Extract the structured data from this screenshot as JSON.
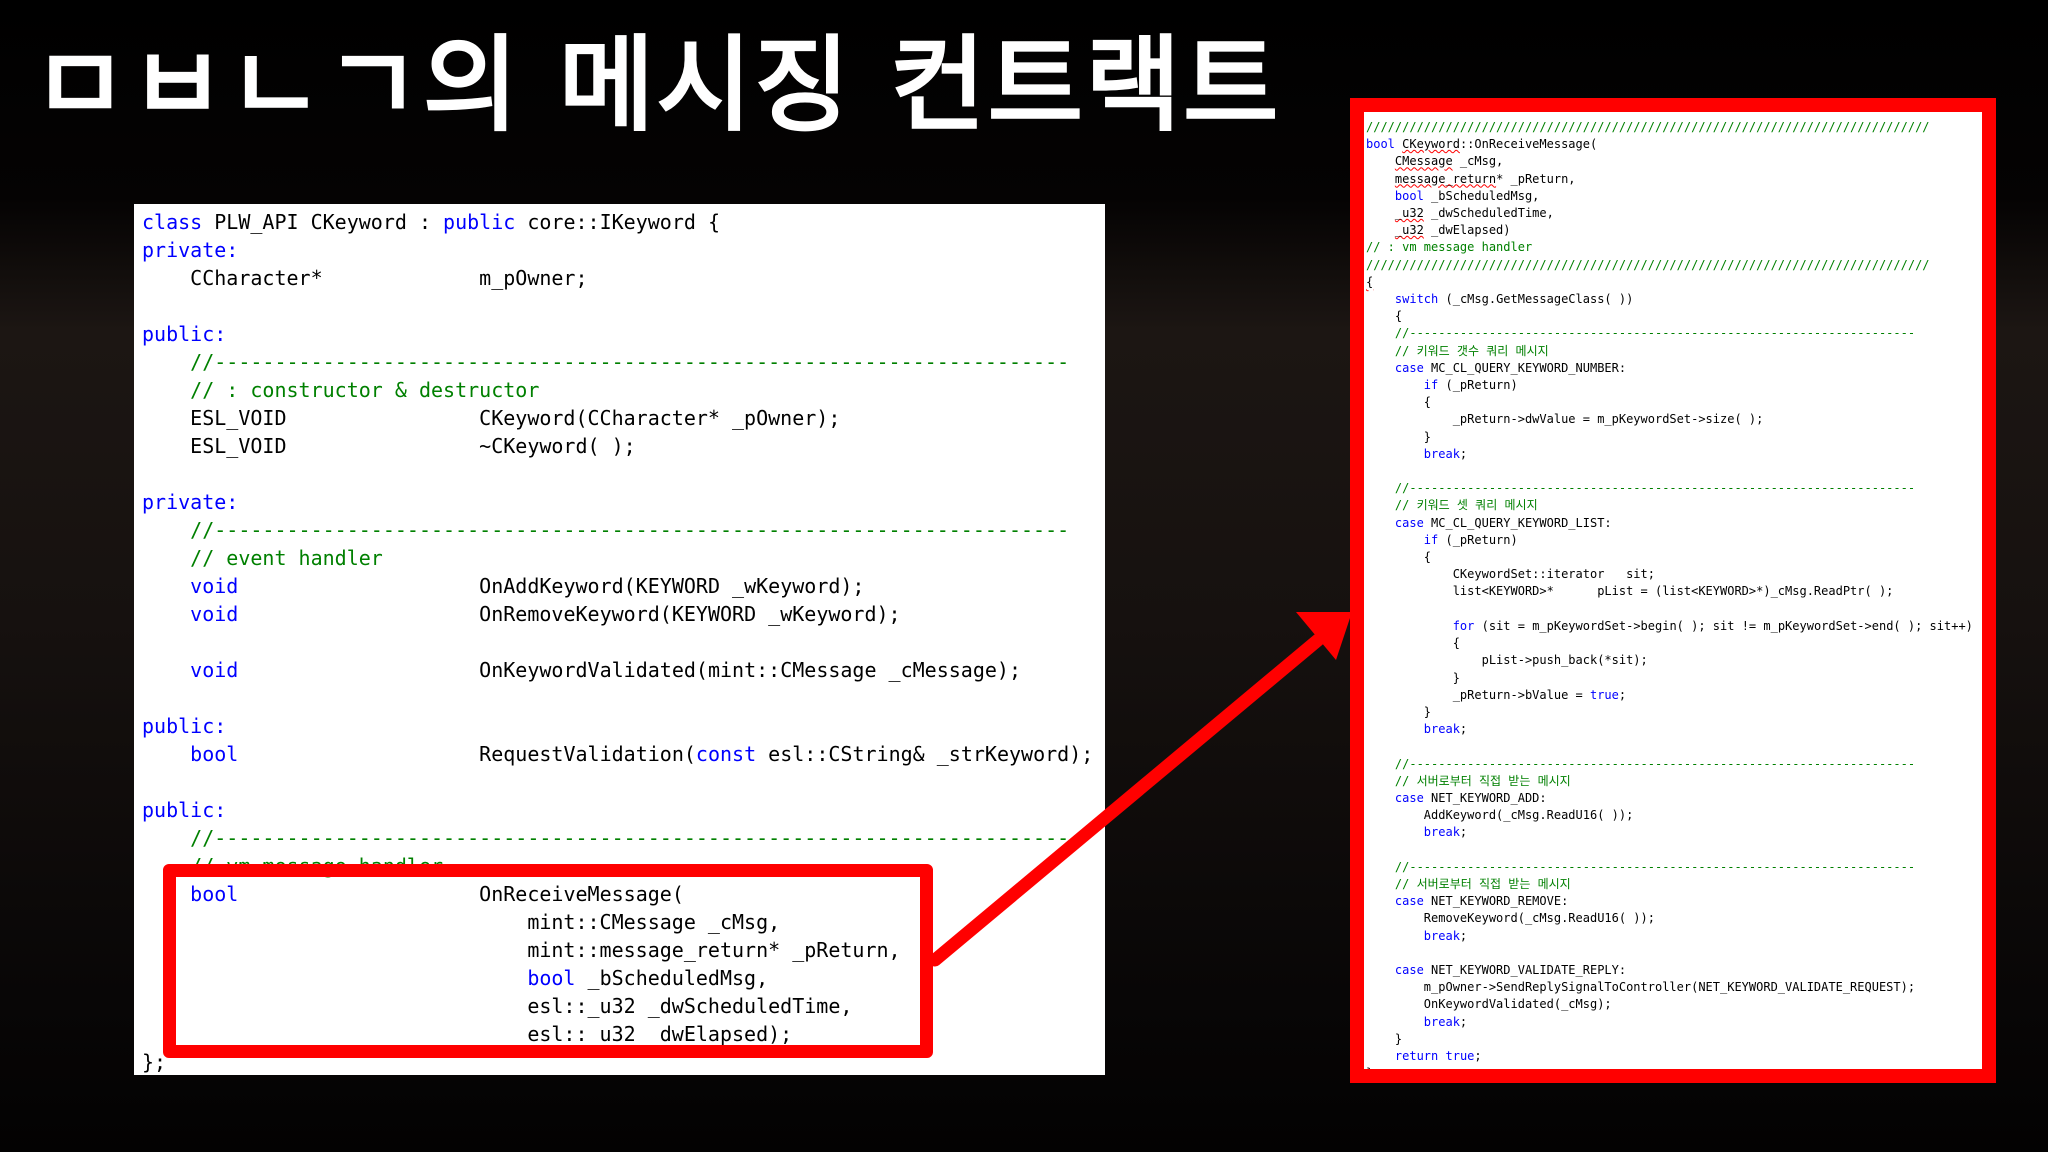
{
  "slide": {
    "title": "ㅁㅂㄴㄱ의 메시징 컨트랙트"
  },
  "colors": {
    "background": "#000000",
    "title": "#ffffff",
    "highlight_red": "#ff0000",
    "keyword_blue": "#0000ff",
    "comment_green": "#008000"
  },
  "left_code": {
    "lines": [
      [
        {
          "t": "class",
          "c": "kw"
        },
        {
          "t": " PLW_API CKeyword : "
        },
        {
          "t": "public",
          "c": "kw"
        },
        {
          "t": " core::IKeyword {"
        }
      ],
      [
        {
          "t": "private:",
          "c": "kw"
        }
      ],
      [
        {
          "t": "    CCharacter*             m_pOwner;"
        }
      ],
      [],
      [
        {
          "t": "public:",
          "c": "kw"
        }
      ],
      [
        {
          "t": "    //-----------------------------------------------------------------------",
          "c": "cm"
        }
      ],
      [
        {
          "t": "    // : constructor & destructor",
          "c": "cm"
        }
      ],
      [
        {
          "t": "    ESL_VOID                CKeyword(CCharacter* _pOwner);"
        }
      ],
      [
        {
          "t": "    ESL_VOID                ~CKeyword( );"
        }
      ],
      [],
      [
        {
          "t": "private:",
          "c": "kw"
        }
      ],
      [
        {
          "t": "    //-----------------------------------------------------------------------",
          "c": "cm"
        }
      ],
      [
        {
          "t": "    // event handler",
          "c": "cm"
        }
      ],
      [
        {
          "t": "    "
        },
        {
          "t": "void",
          "c": "kw"
        },
        {
          "t": "                    OnAddKeyword(KEYWORD _wKeyword);"
        }
      ],
      [
        {
          "t": "    "
        },
        {
          "t": "void",
          "c": "kw"
        },
        {
          "t": "                    OnRemoveKeyword(KEYWORD _wKeyword);"
        }
      ],
      [],
      [
        {
          "t": "    "
        },
        {
          "t": "void",
          "c": "kw"
        },
        {
          "t": "                    OnKeywordValidated(mint::CMessage _cMessage);"
        }
      ],
      [],
      [
        {
          "t": "public:",
          "c": "kw"
        }
      ],
      [
        {
          "t": "    "
        },
        {
          "t": "bool",
          "c": "kw"
        },
        {
          "t": "                    RequestValidation("
        },
        {
          "t": "const",
          "c": "kw"
        },
        {
          "t": " esl::CString& _strKeyword);"
        }
      ],
      [],
      [
        {
          "t": "public:",
          "c": "kw"
        }
      ],
      [
        {
          "t": "    //-----------------------------------------------------------------------",
          "c": "cm"
        }
      ],
      [
        {
          "t": "    // vm message handler",
          "c": "cm"
        }
      ],
      [
        {
          "t": "    "
        },
        {
          "t": "bool",
          "c": "kw"
        },
        {
          "t": "                    OnReceiveMessage("
        }
      ],
      [
        {
          "t": "                                mint::CMessage _cMsg,"
        }
      ],
      [
        {
          "t": "                                mint::message_return* _pReturn,"
        }
      ],
      [
        {
          "t": "                                "
        },
        {
          "t": "bool",
          "c": "kw"
        },
        {
          "t": " _bScheduledMsg,"
        }
      ],
      [
        {
          "t": "                                esl::_u32 _dwScheduledTime,"
        }
      ],
      [
        {
          "t": "                                esl::_u32 _dwElapsed);"
        }
      ],
      [
        {
          "t": "};"
        }
      ]
    ]
  },
  "right_code": {
    "lines": [
      [
        {
          "t": "//////////////////////////////////////////////////////////////////////////////",
          "c": "cm"
        }
      ],
      [
        {
          "t": "bool",
          "c": "kw"
        },
        {
          "t": " "
        },
        {
          "t": "CKeyword",
          "c": "sq"
        },
        {
          "t": "::OnReceiveMessage("
        }
      ],
      [
        {
          "t": "    "
        },
        {
          "t": "CMessage",
          "c": "sq"
        },
        {
          "t": " _cMsg,"
        }
      ],
      [
        {
          "t": "    "
        },
        {
          "t": "message_return",
          "c": "sq"
        },
        {
          "t": "* _pReturn,"
        }
      ],
      [
        {
          "t": "    "
        },
        {
          "t": "bool",
          "c": "kw"
        },
        {
          "t": " _bScheduledMsg,"
        }
      ],
      [
        {
          "t": "    "
        },
        {
          "t": "_u32",
          "c": "sq"
        },
        {
          "t": " _dwScheduledTime,"
        }
      ],
      [
        {
          "t": "    "
        },
        {
          "t": "_u32",
          "c": "sq"
        },
        {
          "t": " _dwElapsed)"
        }
      ],
      [
        {
          "t": "// : vm message handler",
          "c": "cm"
        }
      ],
      [
        {
          "t": "//////////////////////////////////////////////////////////////////////////////",
          "c": "cm"
        }
      ],
      [
        {
          "t": "{",
          "c": "sq"
        }
      ],
      [
        {
          "t": "    "
        },
        {
          "t": "switch",
          "c": "kw"
        },
        {
          "t": " (_cMsg.GetMessageClass( ))"
        }
      ],
      [
        {
          "t": "    {"
        }
      ],
      [
        {
          "t": "    //----------------------------------------------------------------------",
          "c": "cm"
        }
      ],
      [
        {
          "t": "    // 키워드 갯수 쿼리 메시지",
          "c": "cm"
        }
      ],
      [
        {
          "t": "    "
        },
        {
          "t": "case",
          "c": "kw"
        },
        {
          "t": " MC_CL_QUERY_KEYWORD_NUMBER:"
        }
      ],
      [
        {
          "t": "        "
        },
        {
          "t": "if",
          "c": "kw"
        },
        {
          "t": " (_pReturn)"
        }
      ],
      [
        {
          "t": "        {"
        }
      ],
      [
        {
          "t": "            _pReturn->dwValue = m_pKeywordSet->size( );"
        }
      ],
      [
        {
          "t": "        }"
        }
      ],
      [
        {
          "t": "        "
        },
        {
          "t": "break",
          "c": "kw"
        },
        {
          "t": ";"
        }
      ],
      [],
      [
        {
          "t": "    //----------------------------------------------------------------------",
          "c": "cm"
        }
      ],
      [
        {
          "t": "    // 키워드 셋 쿼리 메시지",
          "c": "cm"
        }
      ],
      [
        {
          "t": "    "
        },
        {
          "t": "case",
          "c": "kw"
        },
        {
          "t": " MC_CL_QUERY_KEYWORD_LIST:"
        }
      ],
      [
        {
          "t": "        "
        },
        {
          "t": "if",
          "c": "kw"
        },
        {
          "t": " (_pReturn)"
        }
      ],
      [
        {
          "t": "        {"
        }
      ],
      [
        {
          "t": "            CKeywordSet::iterator   sit;"
        }
      ],
      [
        {
          "t": "            list<KEYWORD>*      pList = (list<KEYWORD>*)_cMsg.ReadPtr( );"
        }
      ],
      [],
      [
        {
          "t": "            "
        },
        {
          "t": "for",
          "c": "kw"
        },
        {
          "t": " (sit = m_pKeywordSet->begin( ); sit != m_pKeywordSet->end( ); sit++)"
        }
      ],
      [
        {
          "t": "            {"
        }
      ],
      [
        {
          "t": "                pList->push_back(*sit);"
        }
      ],
      [
        {
          "t": "            }"
        }
      ],
      [
        {
          "t": "            _pReturn->bValue = "
        },
        {
          "t": "true",
          "c": "kw"
        },
        {
          "t": ";"
        }
      ],
      [
        {
          "t": "        }"
        }
      ],
      [
        {
          "t": "        "
        },
        {
          "t": "break",
          "c": "kw"
        },
        {
          "t": ";"
        }
      ],
      [],
      [
        {
          "t": "    //----------------------------------------------------------------------",
          "c": "cm"
        }
      ],
      [
        {
          "t": "    // 서버로부터 직접 받는 메시지",
          "c": "cm"
        }
      ],
      [
        {
          "t": "    "
        },
        {
          "t": "case",
          "c": "kw"
        },
        {
          "t": " NET_KEYWORD_ADD:"
        }
      ],
      [
        {
          "t": "        AddKeyword(_cMsg.ReadU16( ));"
        }
      ],
      [
        {
          "t": "        "
        },
        {
          "t": "break",
          "c": "kw"
        },
        {
          "t": ";"
        }
      ],
      [],
      [
        {
          "t": "    //----------------------------------------------------------------------",
          "c": "cm"
        }
      ],
      [
        {
          "t": "    // 서버로부터 직접 받는 메시지",
          "c": "cm"
        }
      ],
      [
        {
          "t": "    "
        },
        {
          "t": "case",
          "c": "kw"
        },
        {
          "t": " NET_KEYWORD_REMOVE:"
        }
      ],
      [
        {
          "t": "        RemoveKeyword(_cMsg.ReadU16( ));"
        }
      ],
      [
        {
          "t": "        "
        },
        {
          "t": "break",
          "c": "kw"
        },
        {
          "t": ";"
        }
      ],
      [],
      [
        {
          "t": "    "
        },
        {
          "t": "case",
          "c": "kw"
        },
        {
          "t": " NET_KEYWORD_VALIDATE_REPLY:"
        }
      ],
      [
        {
          "t": "        m_pOwner->SendReplySignalToController(NET_KEYWORD_VALIDATE_REQUEST);"
        }
      ],
      [
        {
          "t": "        OnKeywordValidated(_cMsg);"
        }
      ],
      [
        {
          "t": "        "
        },
        {
          "t": "break",
          "c": "kw"
        },
        {
          "t": ";"
        }
      ],
      [
        {
          "t": "    }"
        }
      ],
      [
        {
          "t": "    "
        },
        {
          "t": "return",
          "c": "kw"
        },
        {
          "t": " "
        },
        {
          "t": "true",
          "c": "kw"
        },
        {
          "t": ";"
        }
      ],
      [
        {
          "t": "}"
        }
      ]
    ]
  }
}
